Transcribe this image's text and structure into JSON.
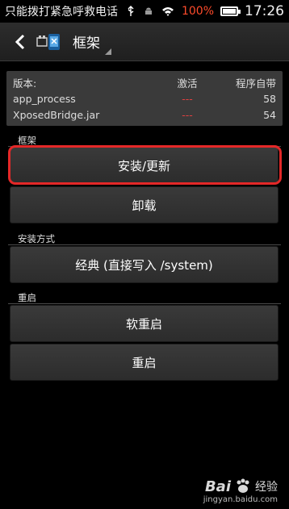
{
  "status_bar": {
    "carrier": "只能拨打紧急呼救电话",
    "battery": "100%",
    "battery_level": 1.0,
    "time": "17:26",
    "icons": [
      "usb-icon",
      "android-debug-icon",
      "wifi-icon",
      "battery-icon"
    ]
  },
  "action_bar": {
    "title": "框架",
    "back_icon": "back-chevron-icon",
    "app_icon": "xposed-app-icon"
  },
  "info_table": {
    "headers": [
      "版本:",
      "激活",
      "程序自带"
    ],
    "rows": [
      {
        "name": "app_process",
        "active": "---",
        "bundled": "58"
      },
      {
        "name": "XposedBridge.jar",
        "active": "---",
        "bundled": "54"
      }
    ]
  },
  "sections": {
    "framework": "框架",
    "install_method": "安装方式",
    "reboot": "重启"
  },
  "buttons": {
    "install_update": "安装/更新",
    "uninstall": "卸载",
    "classic": "经典 (直接写入 /system)",
    "soft_reboot": "软重启",
    "reboot": "重启"
  },
  "watermark": {
    "brand": "Bai",
    "suffix": "经验",
    "url": "jingyan.baidu.com"
  },
  "colors": {
    "accent_red": "#e42828",
    "battery_text": "#ff4b2b"
  }
}
